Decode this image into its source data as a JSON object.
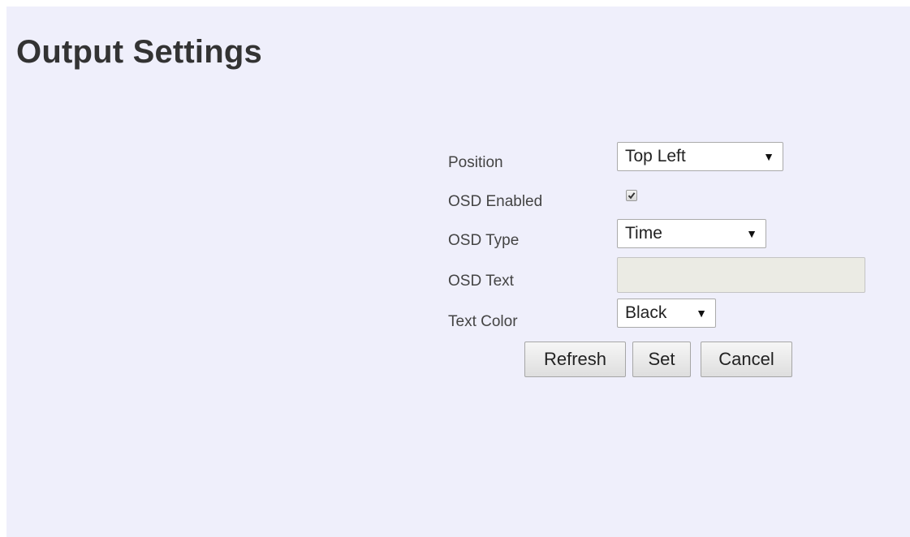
{
  "page": {
    "title": "Output Settings",
    "background_color": "#efeffb"
  },
  "form": {
    "position": {
      "label": "Position",
      "value": "Top Left"
    },
    "osd_enabled": {
      "label": "OSD Enabled",
      "checked": true
    },
    "osd_type": {
      "label": "OSD Type",
      "value": "Time"
    },
    "osd_text": {
      "label": "OSD Text",
      "value": "",
      "disabled": true
    },
    "text_color": {
      "label": "Text Color",
      "value": "Black"
    }
  },
  "buttons": {
    "refresh": "Refresh",
    "set": "Set",
    "cancel": "Cancel"
  },
  "icons": {
    "dropdown_arrow": "▼",
    "checkmark": "checkmark-icon"
  }
}
